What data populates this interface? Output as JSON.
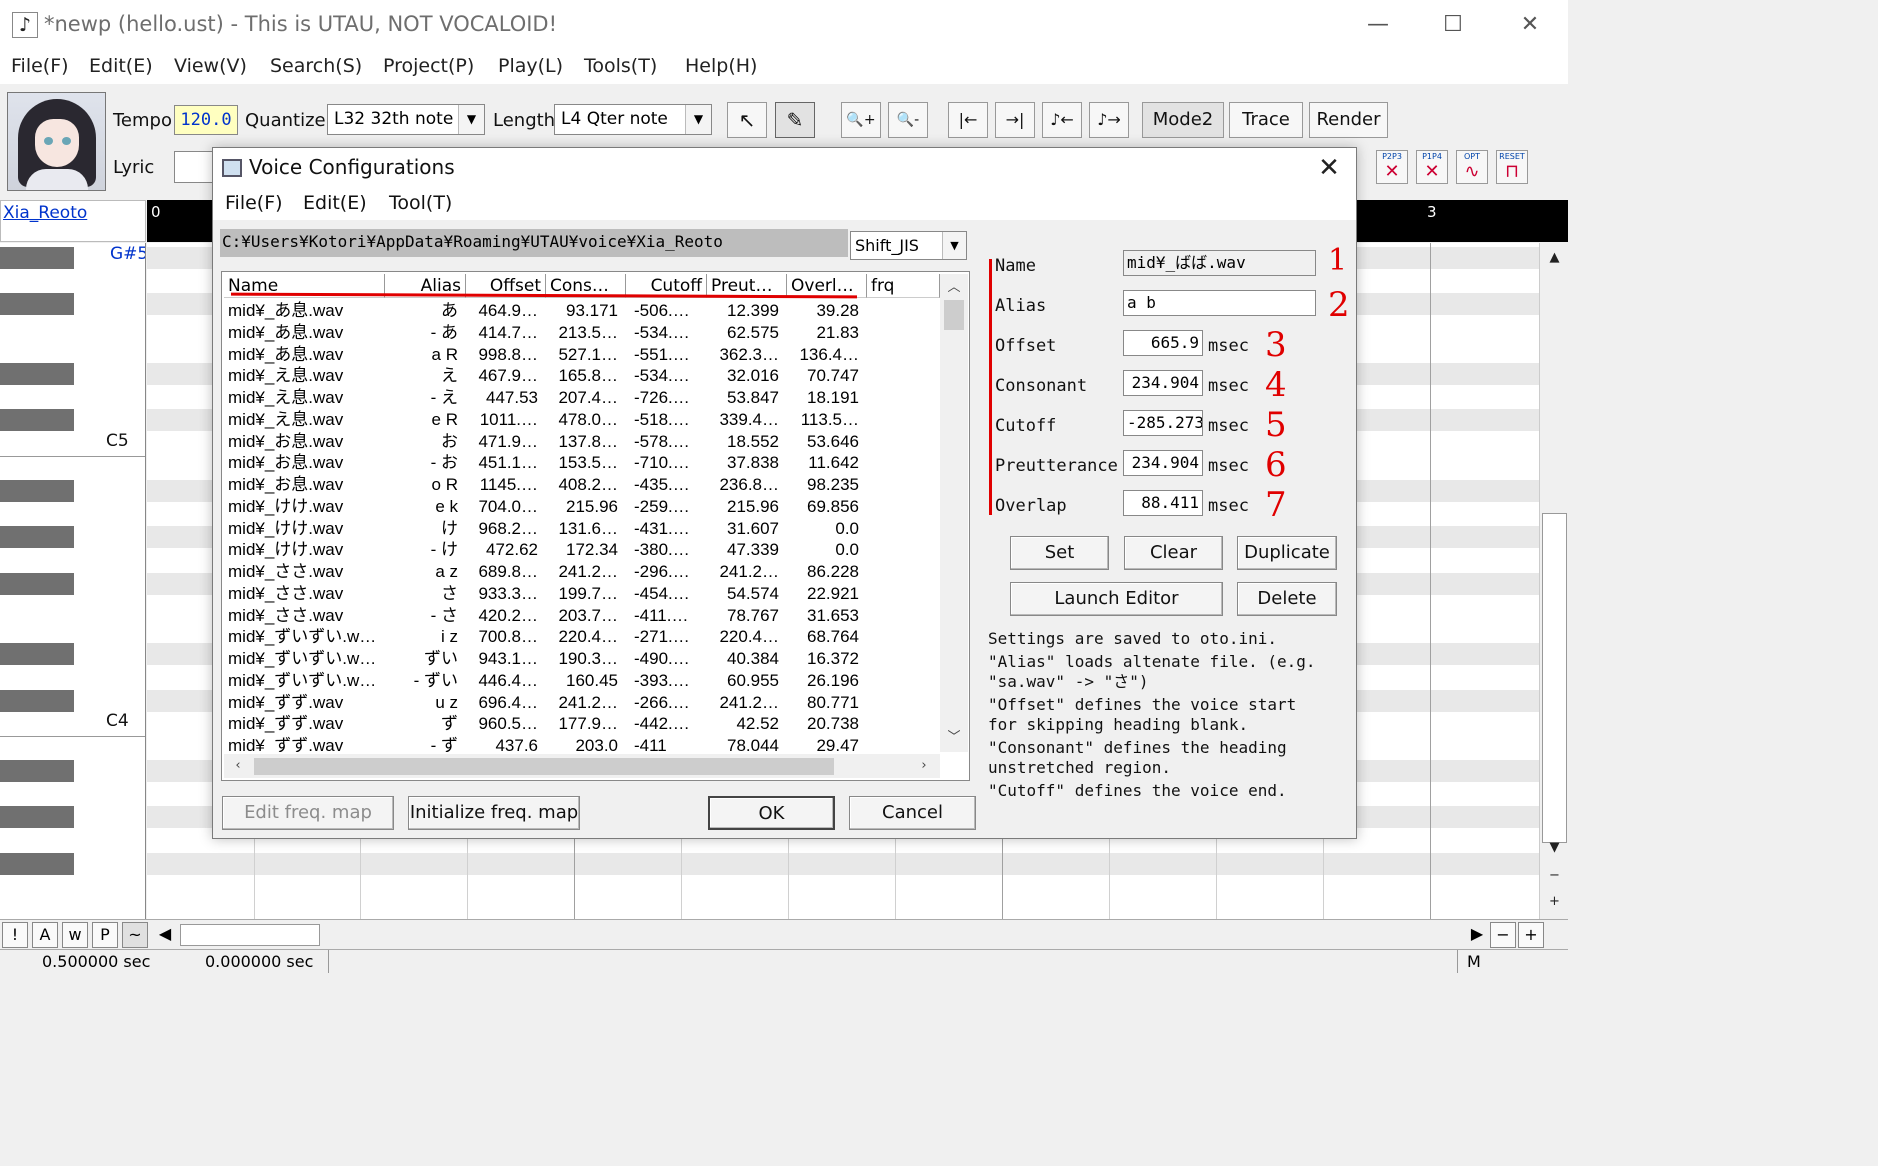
{
  "window": {
    "title": "*newp (hello.ust) - This is UTAU, NOT VOCALOID!",
    "minimize": "—",
    "maximize": "☐",
    "close": "✕"
  },
  "menu": [
    "File(F)",
    "Edit(E)",
    "View(V)",
    "Search(S)",
    "Project(P)",
    "Play(L)",
    "Tools(T)",
    "Help(H)"
  ],
  "toolbar": {
    "tempo_label": "Tempo",
    "tempo_value": "120.0",
    "quantize_label": "Quantize",
    "quantize_value": "L32 32th note",
    "length_label": "Length",
    "length_value": "L4  Qter note",
    "lyric_label": "Lyric",
    "mode2": "Mode2",
    "trace": "Trace",
    "render": "Render",
    "effects": [
      {
        "top": "P2P3",
        "glyph": "✕"
      },
      {
        "top": "P1P4",
        "glyph": "✕"
      },
      {
        "top": "OPT",
        "glyph": "∿"
      },
      {
        "top": "RESET",
        "glyph": "⊓"
      }
    ],
    "icons": {
      "pointer": "↖",
      "pencil": "✎",
      "zoom_in": "🔍+",
      "zoom_out": "🔍-",
      "to_start": "|←",
      "to_end": "→|",
      "split": "♪←",
      "merge": "♪→"
    }
  },
  "singer_name": "Xia_Reoto",
  "timeline": {
    "mark0": "0",
    "mark3": "3"
  },
  "piano_labels": {
    "g5": "G#5",
    "c5": "C5",
    "c4": "C4"
  },
  "bottom_buttons": [
    "!",
    "A",
    "w",
    "P",
    "~"
  ],
  "status": {
    "left": "0.500000 sec",
    "mid": "0.000000 sec",
    "right": "M"
  },
  "dialog": {
    "title": "Voice Configurations",
    "close": "✕",
    "menu": [
      "File(F)",
      "Edit(E)",
      "Tool(T)"
    ],
    "path": "C:¥Users¥Kotori¥AppData¥Roaming¥UTAU¥voice¥Xia_Reoto",
    "encoding": "Shift_JIS",
    "columns": [
      "Name",
      "Alias",
      "Offset",
      "Cons…",
      "Cutoff",
      "Preut…",
      "Overl…",
      "frq"
    ],
    "rows": [
      [
        "mid¥_あ息.wav",
        "あ",
        "464.9…",
        "93.171",
        "-506.…",
        "12.399",
        "39.28"
      ],
      [
        "mid¥_あ息.wav",
        "- あ",
        "414.7…",
        "213.5…",
        "-534.…",
        "62.575",
        "21.83"
      ],
      [
        "mid¥_あ息.wav",
        "a R",
        "998.8…",
        "527.1…",
        "-551.…",
        "362.3…",
        "136.4…"
      ],
      [
        "mid¥_え息.wav",
        "え",
        "467.9…",
        "165.8…",
        "-534.…",
        "32.016",
        "70.747"
      ],
      [
        "mid¥_え息.wav",
        "- え",
        "447.53",
        "207.4…",
        "-726.…",
        "53.847",
        "18.191"
      ],
      [
        "mid¥_え息.wav",
        "e R",
        "1011.…",
        "478.0…",
        "-518.…",
        "339.4…",
        "113.5…"
      ],
      [
        "mid¥_お息.wav",
        "お",
        "471.9…",
        "137.8…",
        "-578.…",
        "18.552",
        "53.646"
      ],
      [
        "mid¥_お息.wav",
        "- お",
        "451.1…",
        "153.5…",
        "-710.…",
        "37.838",
        "11.642"
      ],
      [
        "mid¥_お息.wav",
        "o R",
        "1145.…",
        "408.2…",
        "-435.…",
        "236.8…",
        "98.235"
      ],
      [
        "mid¥_けけ.wav",
        "e k",
        "704.0…",
        "215.96",
        "-259.…",
        "215.96",
        "69.856"
      ],
      [
        "mid¥_けけ.wav",
        "け",
        "968.2…",
        "131.6…",
        "-431.…",
        "31.607",
        "0.0"
      ],
      [
        "mid¥_けけ.wav",
        "- け",
        "472.62",
        "172.34",
        "-380.…",
        "47.339",
        "0.0"
      ],
      [
        "mid¥_ささ.wav",
        "a z",
        "689.8…",
        "241.2…",
        "-296.…",
        "241.2…",
        "86.228"
      ],
      [
        "mid¥_ささ.wav",
        "さ",
        "933.3…",
        "199.7…",
        "-454.…",
        "54.574",
        "22.921"
      ],
      [
        "mid¥_ささ.wav",
        "- さ",
        "420.2…",
        "203.7…",
        "-411.…",
        "78.767",
        "31.653"
      ],
      [
        "mid¥_ずいずい.w…",
        "i z",
        "700.8…",
        "220.4…",
        "-271.…",
        "220.4…",
        "68.764"
      ],
      [
        "mid¥_ずいずい.w…",
        "ずい",
        "943.1…",
        "190.3…",
        "-490.…",
        "40.384",
        "16.372"
      ],
      [
        "mid¥_ずいずい.w…",
        "- ずい",
        "446.4…",
        "160.45",
        "-393.…",
        "60.955",
        "26.196"
      ],
      [
        "mid¥_ずず.wav",
        "u z",
        "696.4…",
        "241.2…",
        "-266.…",
        "241.2…",
        "80.771"
      ],
      [
        "mid¥_ずず.wav",
        "ず",
        "960.5…",
        "177.9…",
        "-442.…",
        "42.52",
        "20.738"
      ],
      [
        "mid¥_ずず.wav",
        "- ず",
        "437.6",
        "203.0",
        "-411",
        "78.044",
        "29.47"
      ]
    ],
    "form": {
      "name_label": "Name",
      "name_value": "mid¥_ばば.wav",
      "alias_label": "Alias",
      "alias_value": "a b",
      "offset_label": "Offset",
      "offset_value": "665.9",
      "consonant_label": "Consonant",
      "consonant_value": "234.904",
      "cutoff_label": "Cutoff",
      "cutoff_value": "-285.273",
      "preutterance_label": "Preutterance",
      "preutterance_value": "234.904",
      "overlap_label": "Overlap",
      "overlap_value": "88.411",
      "unit": "msec"
    },
    "annotations": [
      "1",
      "2",
      "3",
      "4",
      "5",
      "6",
      "7"
    ],
    "buttons": {
      "set": "Set",
      "clear": "Clear",
      "duplicate": "Duplicate",
      "launch_editor": "Launch Editor",
      "delete": "Delete",
      "edit_freq": "Edit freq. map",
      "init_freq": "Initialize freq. map",
      "ok": "OK",
      "cancel": "Cancel"
    },
    "help": [
      "Settings are saved to oto.ini.",
      "\"Alias\" loads altenate file. (e.g.\n\"sa.wav\" -> \"さ\")",
      "\"Offset\" defines the voice start\nfor skipping heading blank.",
      "\"Consonant\" defines the heading\nunstretched region.",
      "\"Cutoff\" defines the voice end."
    ],
    "accent_color": "#e00000"
  }
}
